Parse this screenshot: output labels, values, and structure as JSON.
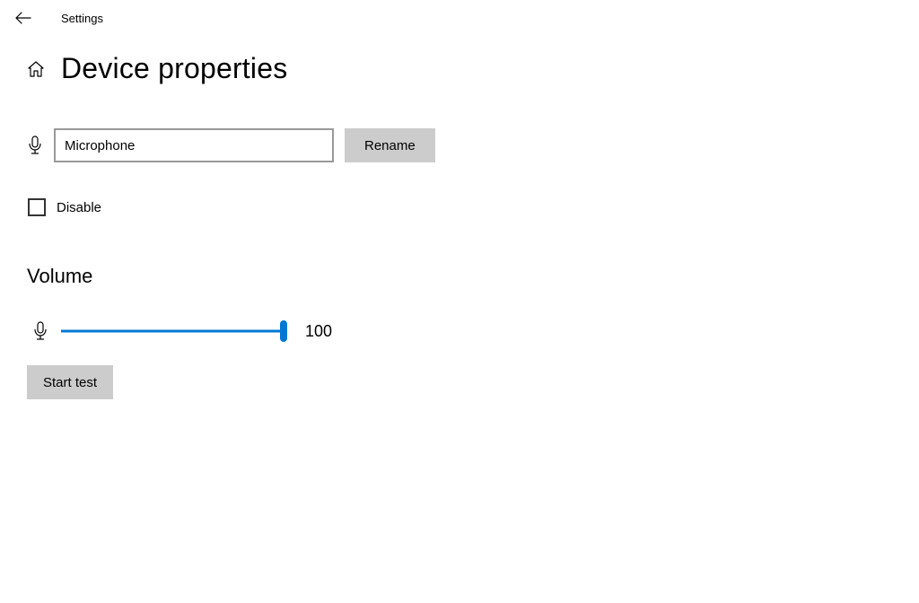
{
  "header": {
    "breadcrumb": "Settings"
  },
  "page": {
    "title": "Device properties"
  },
  "device": {
    "name_value": "Microphone",
    "rename_label": "Rename"
  },
  "disable": {
    "label": "Disable",
    "checked": false
  },
  "volume": {
    "heading": "Volume",
    "value": "100",
    "percent": 100
  },
  "test": {
    "button_label": "Start test"
  }
}
